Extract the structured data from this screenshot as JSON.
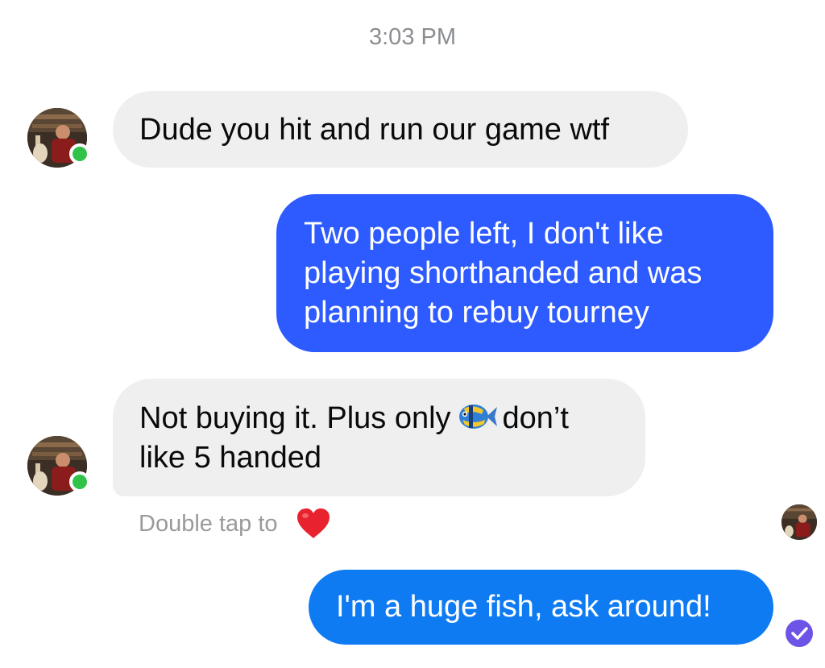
{
  "timestamp": "3:03 PM",
  "messages": [
    {
      "sender": "them",
      "text": "Dude you hit and run our game wtf"
    },
    {
      "sender": "me",
      "lines": [
        "Two people left, I don't like",
        "playing shorthanded and was",
        "planning to rebuy tourney"
      ]
    },
    {
      "sender": "them",
      "line1_before": "Not buying it. Plus only",
      "emoji": "tropical-fish",
      "line1_after": "don’t",
      "line2": "like 5 handed"
    },
    {
      "sender": "me",
      "text": "I'm a huge fish, ask around!"
    }
  ],
  "reaction_hint": {
    "text": "Double tap to",
    "emoji": "red-heart"
  },
  "colors": {
    "incoming_bubble": "#efefef",
    "outgoing_bubble_top": "#2d5bff",
    "outgoing_bubble_bottom": "#0f7bf3",
    "online_indicator": "#31c24a",
    "delivered_check": "#6e54e6"
  }
}
